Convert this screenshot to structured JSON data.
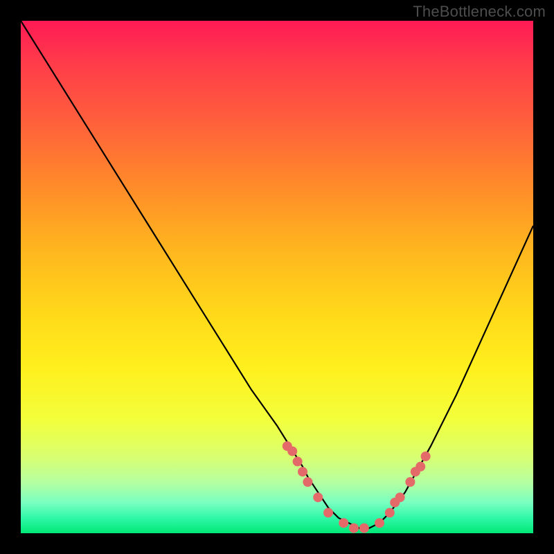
{
  "watermark": "TheBottleneck.com",
  "chart_data": {
    "type": "line",
    "title": "",
    "xlabel": "",
    "ylabel": "",
    "xlim": [
      0,
      100
    ],
    "ylim": [
      0,
      100
    ],
    "grid": false,
    "background": "red-yellow-green vertical gradient",
    "series": [
      {
        "name": "curve",
        "x": [
          0,
          5,
          10,
          15,
          20,
          25,
          30,
          35,
          40,
          45,
          50,
          55,
          56,
          58,
          60,
          62,
          64,
          66,
          68,
          70,
          72,
          75,
          80,
          85,
          90,
          95,
          100
        ],
        "values": [
          100,
          92,
          84,
          76,
          68,
          60,
          52,
          44,
          36,
          28,
          21,
          13,
          11,
          8,
          5,
          3,
          2,
          1,
          1,
          2,
          4,
          8,
          17,
          27,
          38,
          49,
          60
        ]
      }
    ],
    "markers": {
      "name": "highlighted-points",
      "color": "#e46a6a",
      "radius_px": 7,
      "x": [
        52,
        53,
        54,
        55,
        56,
        58,
        60,
        63,
        65,
        67,
        70,
        72,
        73,
        74,
        76,
        77,
        78,
        79
      ],
      "values": [
        17,
        16,
        14,
        12,
        10,
        7,
        4,
        2,
        1,
        1,
        2,
        4,
        6,
        7,
        10,
        12,
        13,
        15
      ]
    },
    "gradient_stops": [
      {
        "pos": 0.0,
        "color": "#ff1a55"
      },
      {
        "pos": 0.5,
        "color": "#ffdb1a"
      },
      {
        "pos": 0.85,
        "color": "#d9ff70"
      },
      {
        "pos": 1.0,
        "color": "#00e876"
      }
    ]
  },
  "colors": {
    "background": "#000000",
    "curve": "#000000",
    "marker": "#e46a6a",
    "watermark": "#4d4d4d"
  }
}
